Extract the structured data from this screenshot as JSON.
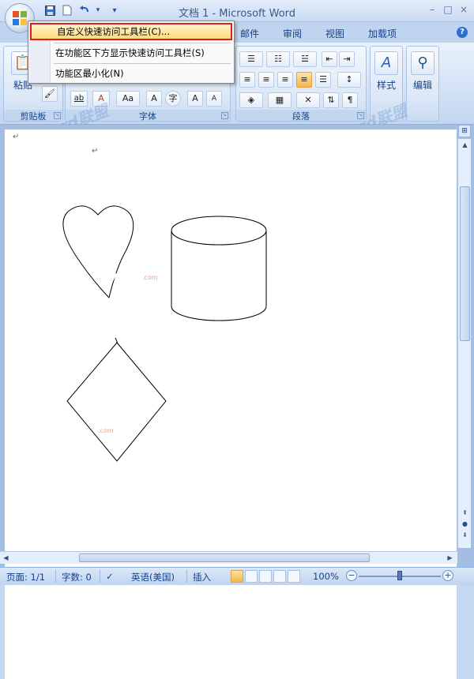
{
  "window": {
    "title": "文档 1 - Microsoft Word",
    "controls": {
      "minimize": "–",
      "restore": "□",
      "close": "×"
    }
  },
  "office_button": {
    "icon": "office-logo"
  },
  "qat": {
    "items": [
      {
        "name": "save-icon",
        "glyph": "💾"
      },
      {
        "name": "new-document-icon",
        "glyph": "🗋"
      },
      {
        "name": "undo-icon",
        "glyph": "↶"
      },
      {
        "name": "undo-dropdown",
        "glyph": "▾"
      },
      {
        "name": "customize-qat-dropdown",
        "glyph": "▾"
      }
    ]
  },
  "tabs": [
    "邮件",
    "审阅",
    "视图",
    "加载项"
  ],
  "help": "?",
  "dropdown_menu": {
    "items": [
      {
        "label": "自定义快速访问工具栏(C)...",
        "highlighted": true
      },
      {
        "label": "在功能区下方显示快速访问工具栏(S)",
        "highlighted": false
      },
      {
        "label": "功能区最小化(N)",
        "highlighted": false
      }
    ]
  },
  "ribbon": {
    "clipboard": {
      "label": "剪贴板",
      "paste_label": "粘贴"
    },
    "font": {
      "label": "字体",
      "buttons": [
        "ab",
        "A",
        "Aa",
        "A",
        "字",
        "A",
        "A"
      ]
    },
    "paragraph": {
      "label": "段落"
    },
    "styles": {
      "label": "样式"
    },
    "editing": {
      "label": "编辑"
    }
  },
  "document": {
    "paragraph_marks": [
      "↵",
      "↵"
    ],
    "watermark_text": "Word联盟",
    "shapes": [
      "heart",
      "can",
      "diamond"
    ]
  },
  "statusbar": {
    "page": "页面: 1/1",
    "words": "字数: 0",
    "language": "英语(美国)",
    "insert": "插入",
    "zoom": "100%",
    "zoom_percent": 100
  },
  "colors": {
    "accent": "#15428b",
    "highlight_border": "#d62020",
    "ribbon_bg": "#d2e1f5"
  }
}
